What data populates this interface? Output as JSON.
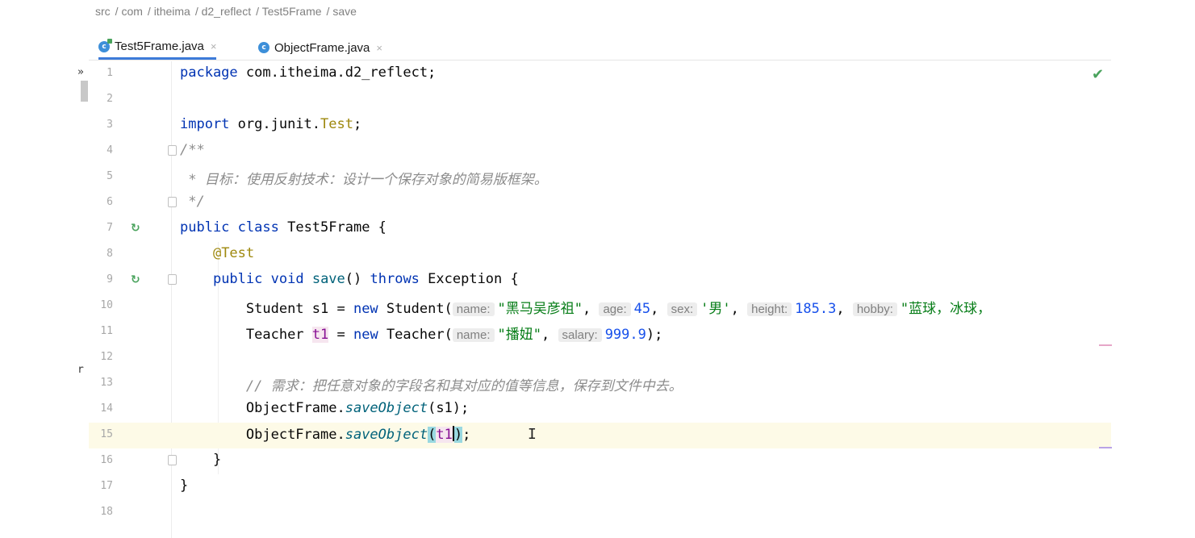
{
  "breadcrumb": [
    "src",
    "com",
    "itheima",
    "d2_reflect",
    "Test5Frame",
    "save"
  ],
  "tabs": [
    {
      "label": "Test5Frame.java",
      "active": true,
      "icon": "runnable-class-icon"
    },
    {
      "label": "ObjectFrame.java",
      "active": false,
      "icon": "class-icon"
    }
  ],
  "close_glyph": "×",
  "left_edge": {
    "a": "»",
    "b": "r"
  },
  "editor": {
    "check_icon": "✔",
    "line_numbers": [
      "1",
      "2",
      "3",
      "4",
      "5",
      "6",
      "7",
      "8",
      "9",
      "10",
      "11",
      "12",
      "13",
      "14",
      "15",
      "16",
      "17",
      "18"
    ],
    "lines": {
      "l1": {
        "kw": "package",
        "rest": " com.itheima.d2_reflect;"
      },
      "l3": {
        "kw": "import",
        "rest": " org.junit.",
        "cls": "Test",
        ";": ";"
      },
      "l4": {
        "text": "/**"
      },
      "l5": {
        "text": " * 目标：使用反射技术：设计一个保存对象的简易版框架。"
      },
      "l6": {
        "text": " */"
      },
      "l7": {
        "kw1": "public",
        "kw2": "class",
        "rest": " Test5Frame {"
      },
      "l8": {
        "ann": "@Test"
      },
      "l9": {
        "kw1": "public",
        "kw2": "void",
        "meth": "save",
        "mid": "() ",
        "kw3": "throws",
        "rest": " Exception {"
      },
      "l10": {
        "a": "Student s1 = ",
        "kw": "new",
        "b": " Student(",
        "h1": "name:",
        "v1": "\"黑马吴彦祖\"",
        "c1": ", ",
        "h2": "age:",
        "v2": "45",
        "c2": ", ",
        "h3": "sex:",
        "v3": "'男'",
        "c3": ", ",
        "h4": "height:",
        "v4": "185.3",
        "c4": ", ",
        "h5": "hobby:",
        "v5": "\"蓝球，冰球，"
      },
      "l11": {
        "a": "Teacher ",
        "var": "t1",
        "b": " = ",
        "kw": "new",
        "c": " Teacher(",
        "h1": "name:",
        "v1": "\"播妞\"",
        "c1": ", ",
        "h2": "salary:",
        "v2": "999.9",
        "end": ");"
      },
      "l13": {
        "text": "// 需求：把任意对象的字段名和其对应的值等信息，保存到文件中去。"
      },
      "l14": {
        "a": "ObjectFrame.",
        "m": "saveObject",
        "b": "(s1);"
      },
      "l15": {
        "a": "ObjectFrame.",
        "m": "saveObject",
        "p": "(",
        "v": "t1",
        "p2": ")",
        "end": ";"
      },
      "l16": {
        "text": "}"
      },
      "l17": {
        "text": "}"
      }
    },
    "gutter_run_icon": "↻",
    "text_cursor_glyph": "I"
  }
}
